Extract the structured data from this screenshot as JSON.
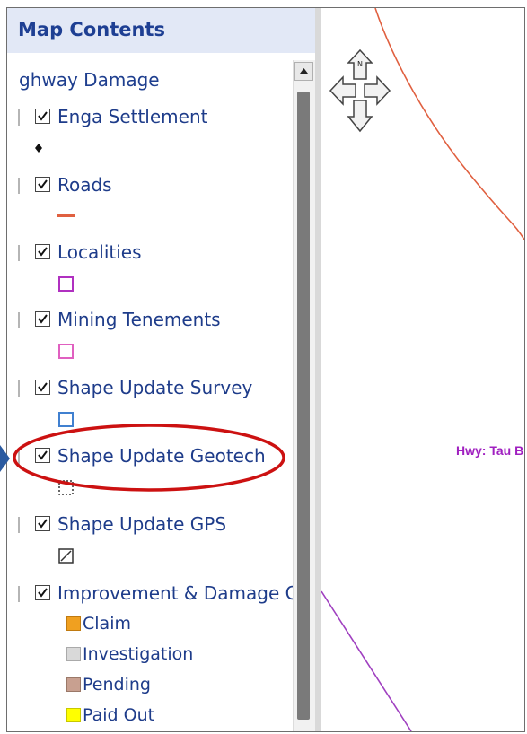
{
  "toc": {
    "title": "Map Contents",
    "service_label": "ghway Damage",
    "layers": [
      {
        "label": "Enga Settlement",
        "checked": true,
        "symbol": "black-point"
      },
      {
        "label": "Roads",
        "checked": true,
        "symbol": "red-line"
      },
      {
        "label": "Localities",
        "checked": true,
        "symbol": "magenta-square"
      },
      {
        "label": "Mining Tenements",
        "checked": true,
        "symbol": "pink-square"
      },
      {
        "label": "Shape Update Survey",
        "checked": true,
        "symbol": "blue-square"
      },
      {
        "label": "Shape Update Geotech",
        "checked": true,
        "symbol": "dotted-square"
      },
      {
        "label": "Shape Update GPS",
        "checked": true,
        "symbol": "hatched-square"
      },
      {
        "label": "Improvement & Damage Cc",
        "checked": true,
        "symbol": "none"
      }
    ],
    "legend": [
      {
        "label": "Claim",
        "color": "#f0a020"
      },
      {
        "label": "Investigation",
        "color": "#d9d9d9"
      },
      {
        "label": "Pending",
        "color": "#c8a090"
      },
      {
        "label": "Paid Out",
        "color": "#ffff00"
      }
    ]
  },
  "map": {
    "highway_label": "Hwy: Tau B",
    "colors": {
      "road": "#e06040",
      "boundary": "#a040c0"
    }
  },
  "annotation": {
    "highlight_color": "#cc1111",
    "arrow_color": "#2a5aa0"
  }
}
